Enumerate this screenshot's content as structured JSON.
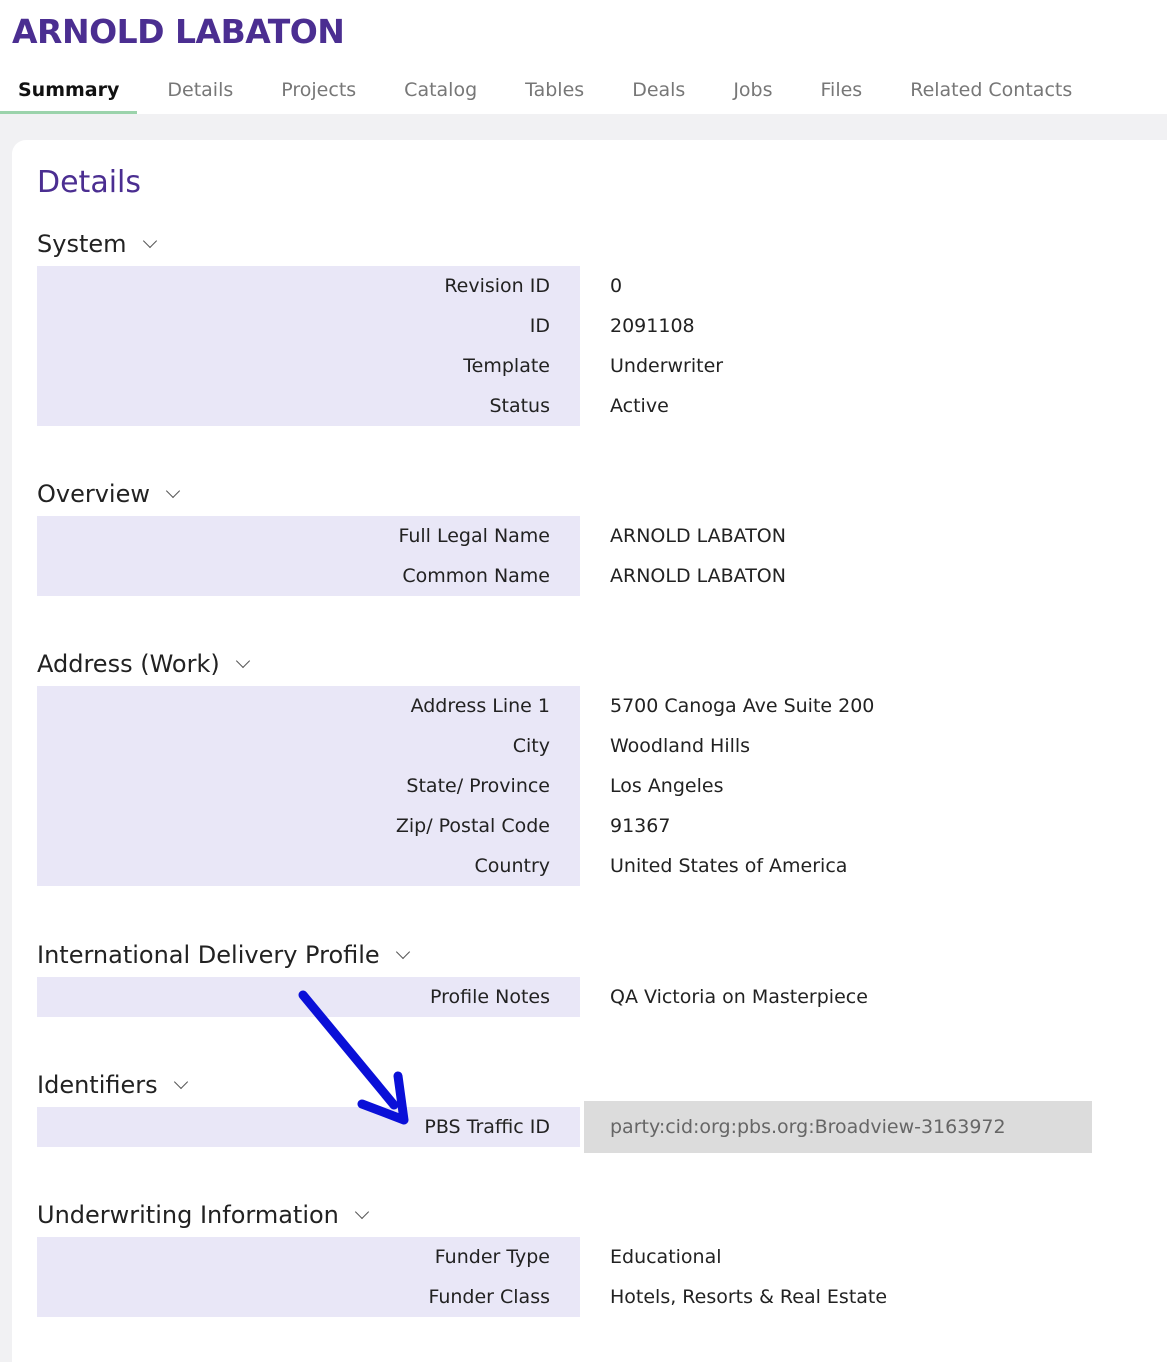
{
  "header": {
    "title": "ARNOLD LABATON"
  },
  "tabs": [
    {
      "label": "Summary"
    },
    {
      "label": "Details"
    },
    {
      "label": "Projects"
    },
    {
      "label": "Catalog"
    },
    {
      "label": "Tables"
    },
    {
      "label": "Deals"
    },
    {
      "label": "Jobs"
    },
    {
      "label": "Files"
    },
    {
      "label": "Related Contacts"
    }
  ],
  "active_tab": "Summary",
  "card": {
    "title": "Details"
  },
  "sections": {
    "system": {
      "title": "System",
      "rows": [
        {
          "label": "Revision ID",
          "value": "0"
        },
        {
          "label": "ID",
          "value": "2091108"
        },
        {
          "label": "Template",
          "value": "Underwriter"
        },
        {
          "label": "Status",
          "value": "Active"
        }
      ]
    },
    "overview": {
      "title": "Overview",
      "rows": [
        {
          "label": "Full Legal Name",
          "value": "ARNOLD LABATON"
        },
        {
          "label": "Common Name",
          "value": "ARNOLD LABATON"
        }
      ]
    },
    "address": {
      "title": "Address (Work)",
      "rows": [
        {
          "label": "Address Line 1",
          "value": "5700 Canoga Ave Suite 200"
        },
        {
          "label": "City",
          "value": "Woodland Hills"
        },
        {
          "label": "State/ Province",
          "value": "Los Angeles"
        },
        {
          "label": "Zip/ Postal Code",
          "value": "91367"
        },
        {
          "label": "Country",
          "value": "United States of America"
        }
      ]
    },
    "intl": {
      "title": "International Delivery Profile",
      "rows": [
        {
          "label": "Profile Notes",
          "value": "QA Victoria on Masterpiece"
        }
      ]
    },
    "identifiers": {
      "title": "Identifiers",
      "rows": [
        {
          "label": "PBS Traffic ID",
          "value": "party:cid:org:pbs.org:Broadview-3163972"
        }
      ]
    },
    "underwriting": {
      "title": "Underwriting Information",
      "rows": [
        {
          "label": "Funder Type",
          "value": "Educational"
        },
        {
          "label": "Funder Class",
          "value": "Hotels, Resorts & Real Estate"
        }
      ]
    }
  },
  "colors": {
    "brand_purple": "#4b2e91",
    "label_bg": "#e9e7f7",
    "active_tab_underline": "#9bd3ab",
    "readonly_bg": "#dcdcdc",
    "annotation_arrow": "#0a10d8"
  },
  "icons": {
    "section_toggle": "chevron-down-icon",
    "annotation": "arrow-annotation"
  }
}
